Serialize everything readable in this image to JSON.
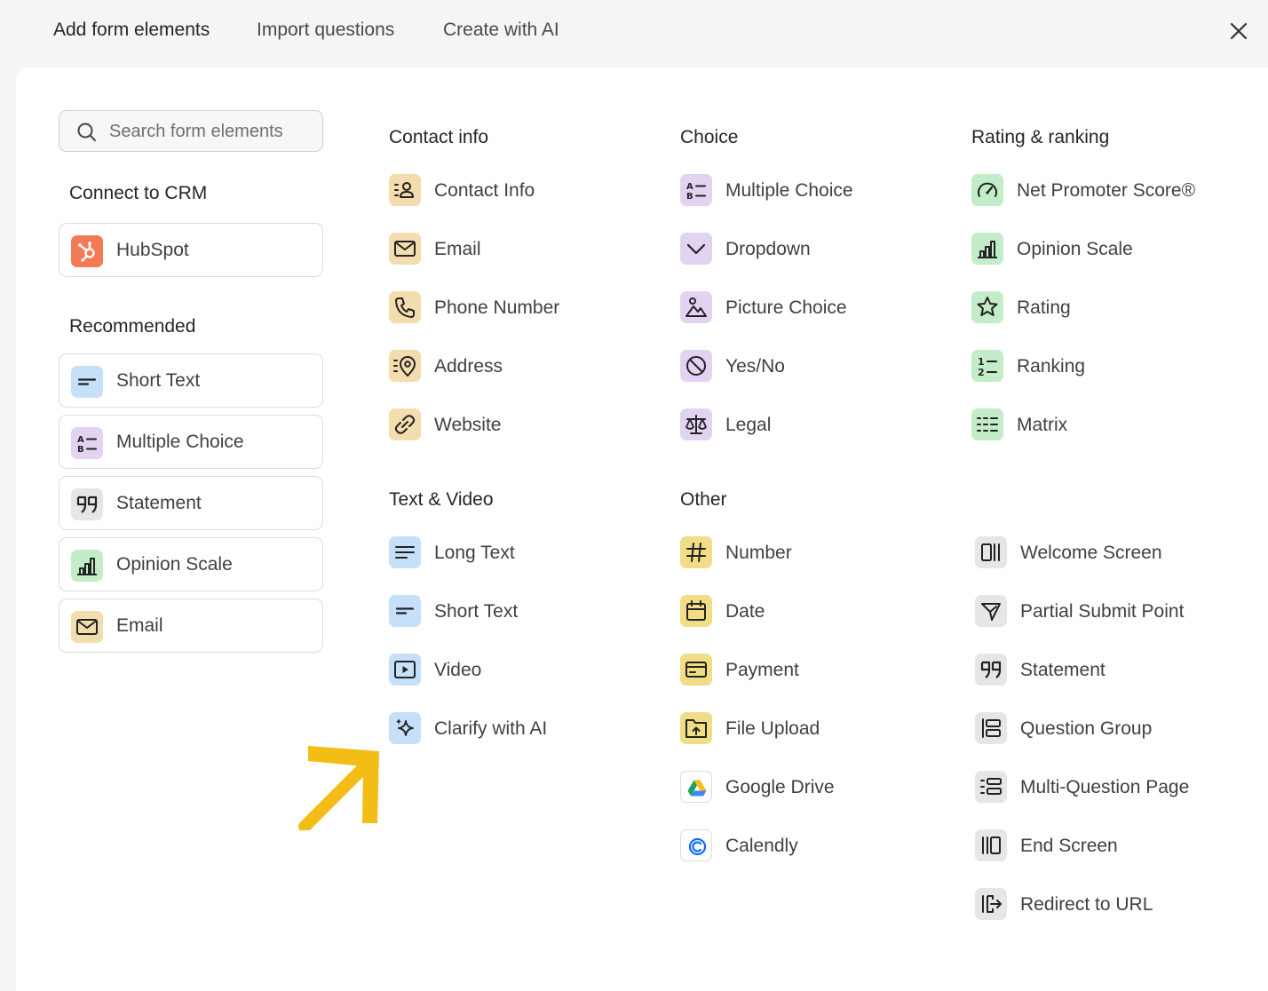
{
  "tabs": [
    "Add form elements",
    "Import questions",
    "Create with AI"
  ],
  "search": {
    "placeholder": "Search form elements"
  },
  "left": {
    "crm_heading": "Connect to CRM",
    "crm_items": [
      {
        "label": "HubSpot",
        "icon": "hubspot-icon",
        "bg": "#f27b55"
      }
    ],
    "recommended_heading": "Recommended",
    "recommended_items": [
      {
        "label": "Short Text",
        "icon": "short-text-icon"
      },
      {
        "label": "Multiple Choice",
        "icon": "multiple-choice-icon"
      },
      {
        "label": "Statement",
        "icon": "quote-icon"
      },
      {
        "label": "Opinion Scale",
        "icon": "bar-chart-icon"
      },
      {
        "label": "Email",
        "icon": "envelope-icon"
      }
    ]
  },
  "sections": {
    "contact": {
      "heading": "Contact info",
      "items": [
        "Contact Info",
        "Email",
        "Phone Number",
        "Address",
        "Website"
      ]
    },
    "choice": {
      "heading": "Choice",
      "items": [
        "Multiple Choice",
        "Dropdown",
        "Picture Choice",
        "Yes/No",
        "Legal"
      ]
    },
    "rating": {
      "heading": "Rating & ranking",
      "items": [
        "Net Promoter Score®",
        "Opinion Scale",
        "Rating",
        "Ranking",
        "Matrix"
      ]
    },
    "text_video": {
      "heading": "Text & Video",
      "items": [
        "Long Text",
        "Short Text",
        "Video",
        "Clarify with AI"
      ]
    },
    "other": {
      "heading": "Other",
      "items": [
        "Number",
        "Date",
        "Payment",
        "File Upload",
        "Google Drive",
        "Calendly"
      ]
    },
    "screens": {
      "items": [
        "Welcome Screen",
        "Partial Submit Point",
        "Statement",
        "Question Group",
        "Multi-Question Page",
        "End Screen",
        "Redirect to URL"
      ]
    }
  },
  "colors": {
    "contact": "#f3dcae",
    "choice": "#e2d3f3",
    "rating": "#c3ecc9",
    "text_video": "#c6e0fa",
    "other": "#f0dd86",
    "screens": "#e6e6e6",
    "annotation_arrow": "#f2bd14"
  }
}
